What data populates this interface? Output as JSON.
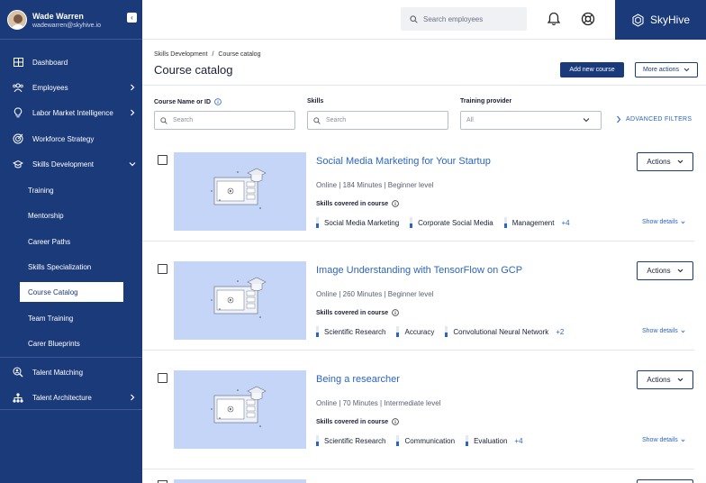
{
  "user": {
    "name": "Wade Warren",
    "email": "wadewarren@skyhive.io"
  },
  "search_top": {
    "placeholder": "Search employees"
  },
  "brand": {
    "name": "SkyHive",
    "color": "#1b3a7a"
  },
  "sidebar": {
    "items": [
      {
        "label": "Dashboard",
        "icon": "dashboard-icon"
      },
      {
        "label": "Employees",
        "icon": "people-icon",
        "has_children": true
      },
      {
        "label": "Labor Market Intelligence",
        "icon": "lightbulb-icon",
        "has_children": true
      },
      {
        "label": "Workforce Strategy",
        "icon": "target-icon"
      },
      {
        "label": "Skills Development",
        "icon": "graduation-cap-icon",
        "has_children": true,
        "expanded": true
      },
      {
        "label": "Talent Matching",
        "icon": "person-search-icon"
      },
      {
        "label": "Talent Architecture",
        "icon": "hierarchy-icon",
        "has_children": true
      }
    ],
    "sub_items": [
      {
        "label": "Training"
      },
      {
        "label": "Mentorship"
      },
      {
        "label": "Career Paths"
      },
      {
        "label": "Skills Specialization"
      },
      {
        "label": "Course Catalog",
        "active": true
      },
      {
        "label": "Team Training"
      },
      {
        "label": "Carer Blueprints"
      }
    ]
  },
  "breadcrumb": {
    "parent": "Skills Development",
    "separator": "/",
    "current": "Course catalog"
  },
  "page": {
    "title": "Course catalog",
    "add_button": "Add new course",
    "more_actions": "More actions"
  },
  "filters": {
    "course_label": "Course Name or ID",
    "course_placeholder": "Search",
    "skills_label": "Skills",
    "skills_placeholder": "Search",
    "provider_label": "Training provider",
    "provider_value": "All",
    "advanced": "ADVANCED FILTERS"
  },
  "courses": [
    {
      "title": "Social Media Marketing for Your Startup",
      "mode": "Online",
      "duration": "184 Minutes",
      "level": "Beginner level",
      "skills_label": "Skills covered in course",
      "skills": [
        "Social Media Marketing",
        "Corporate Social Media",
        "Management"
      ],
      "more": "+4",
      "actions": "Actions",
      "show_details": "Show details"
    },
    {
      "title": "Image Understanding with TensorFlow on GCP",
      "mode": "Online",
      "duration": "260 Minutes",
      "level": "Beginner level",
      "skills_label": "Skills covered in course",
      "skills": [
        "Scientific Research",
        "Accuracy",
        "Convolutional Neural Network"
      ],
      "more": "+2",
      "actions": "Actions",
      "show_details": "Show details"
    },
    {
      "title": "Being a researcher",
      "mode": "Online",
      "duration": "70 Minutes",
      "level": "Intermediate level",
      "skills_label": "Skills covered in course",
      "skills": [
        "Scientific Research",
        "Communication",
        "Evaluation"
      ],
      "more": "+4",
      "actions": "Actions",
      "show_details": "Show details"
    }
  ]
}
